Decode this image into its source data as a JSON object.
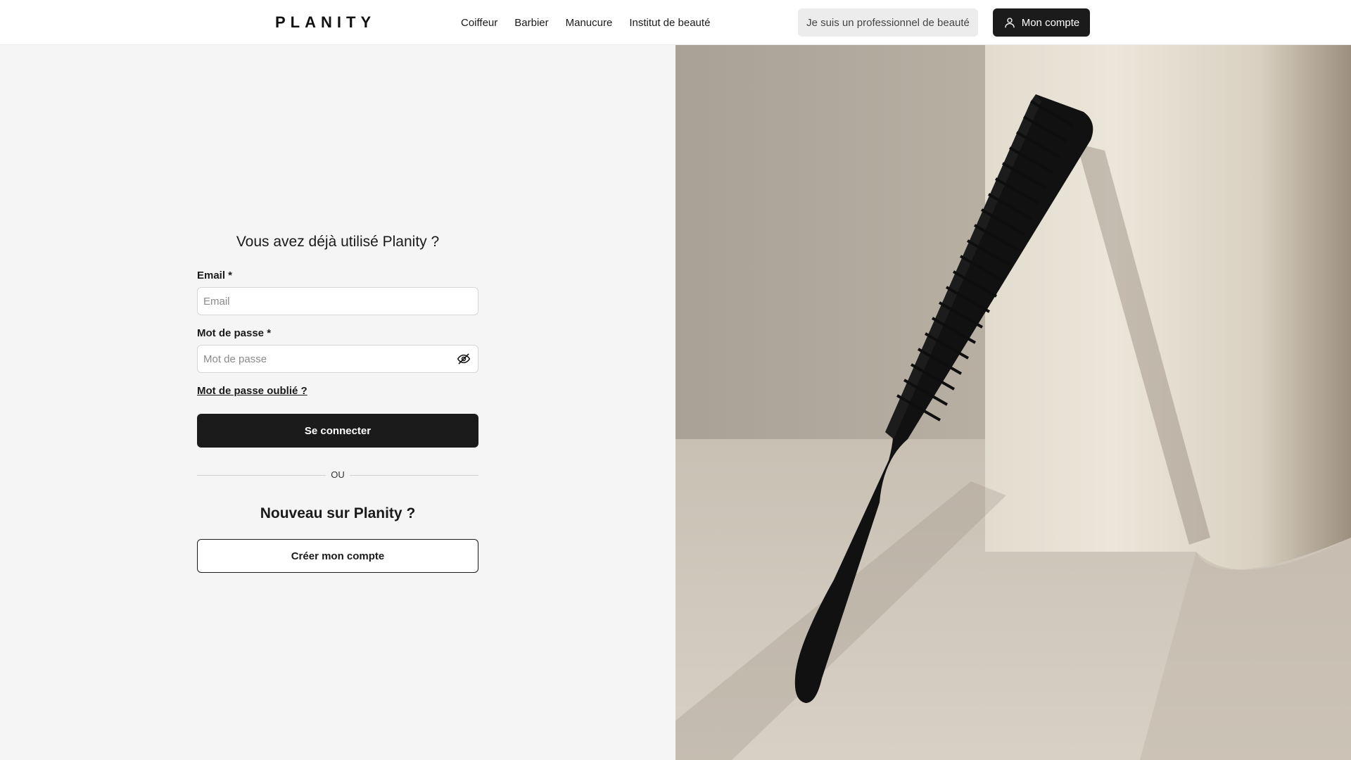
{
  "header": {
    "logo": "PLANITY",
    "nav": [
      "Coiffeur",
      "Barbier",
      "Manucure",
      "Institut de beauté"
    ],
    "pro_label": "Je suis un professionnel de beauté",
    "account_label": "Mon compte"
  },
  "login": {
    "title": "Vous avez déjà utilisé Planity ?",
    "email_label": "Email *",
    "email_placeholder": "Email",
    "password_label": "Mot de passe *",
    "password_placeholder": "Mot de passe",
    "forgot": "Mot de passe oublié ?",
    "submit": "Se connecter",
    "separator": "OU"
  },
  "signup": {
    "title": "Nouveau sur Planity ?",
    "button": "Créer mon compte"
  },
  "colors": {
    "primary": "#1b1b1b",
    "panel_bg": "#f5f5f5"
  },
  "icons": [
    "user-icon",
    "eye-off-icon"
  ],
  "image": {
    "subject": "comb-photo"
  }
}
